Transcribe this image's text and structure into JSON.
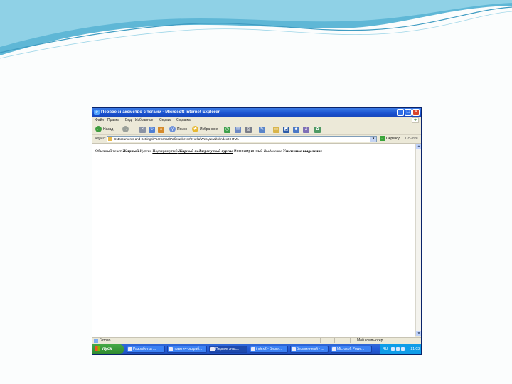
{
  "window": {
    "title": "Первое знакомство с тегами - Microsoft Internet Explorer",
    "controls": [
      "_",
      "□",
      "×"
    ]
  },
  "menu": [
    "Файл",
    "Правка",
    "Вид",
    "Избранное",
    "Сервис",
    "Справка"
  ],
  "toolbar": {
    "back_label": "Назад",
    "search_label": "Поиск",
    "favorites_label": "Избранное"
  },
  "address": {
    "label": "Адрес:",
    "value": "C:\\Documents and Settings\\Ростислав\\Рабочий стол\\Учеба\\Web-дизайн\\index2.HTML",
    "go_label": "Переход",
    "links_label": "Ссылки"
  },
  "page": {
    "segments": [
      "Обычный текст",
      "Жирный",
      "Курсив",
      "Подчеркнутый",
      "Жирный подчеркнутый курсив",
      "Моноширинный",
      "Выделение",
      "Усиленное выделение"
    ]
  },
  "status": {
    "left": "Готово",
    "right": "Мой компьютер"
  },
  "taskbar": {
    "start_label": "пуск",
    "tasks": [
      "Разработка ...",
      "практич-разраб...",
      "Первое знак...",
      "index2 - Блокн...",
      "Безымянный - ...",
      "Microsoft Powe..."
    ],
    "lang": "RU",
    "clock": "21:03"
  }
}
